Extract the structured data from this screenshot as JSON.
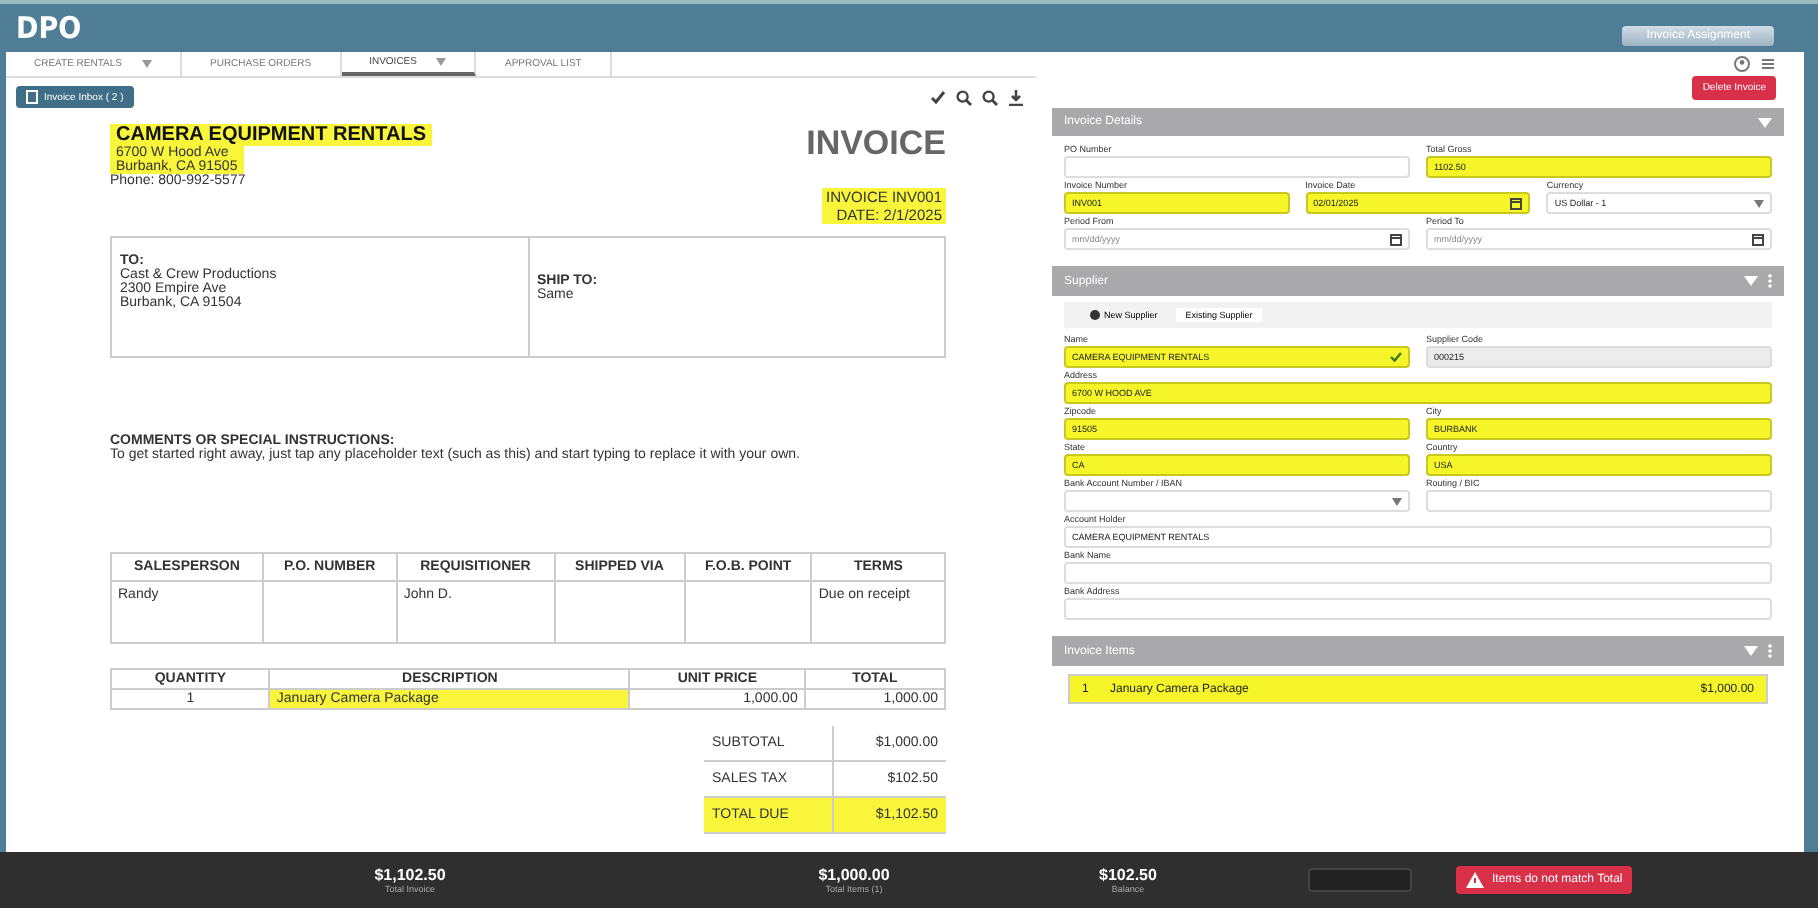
{
  "app": {
    "logo": "DPO",
    "assignment_badge": "Invoice Assignment"
  },
  "tabs": [
    {
      "label": "CREATE RENTALS",
      "selected": false,
      "dropdown": true
    },
    {
      "label": "PURCHASE ORDERS",
      "selected": false,
      "dropdown": false
    },
    {
      "label": "INVOICES",
      "selected": true,
      "dropdown": true
    },
    {
      "label": "APPROVAL LIST",
      "selected": false,
      "dropdown": false
    }
  ],
  "inbox_button": "Invoice Inbox ( 2 )",
  "document": {
    "company": {
      "name": "CAMERA EQUIPMENT RENTALS",
      "address_lines": [
        "6700 W Hood Ave",
        "Burbank, CA 91505"
      ],
      "phone": "Phone: 800-992-5577"
    },
    "title": "INVOICE",
    "invoice_number": "INVOICE INV001",
    "date": "DATE: 2/1/2025",
    "to": {
      "heading": "TO:",
      "lines": [
        "Cast & Crew Productions",
        "2300 Empire Ave",
        "Burbank, CA 91504"
      ]
    },
    "ship_to": {
      "heading": "SHIP TO:",
      "lines": [
        "Same"
      ]
    },
    "comments": {
      "heading": "COMMENTS OR SPECIAL INSTRUCTIONS:",
      "text": "To get started right away, just tap any placeholder text (such as this) and start typing to replace it with your own."
    },
    "order_table": {
      "columns": [
        "SALESPERSON",
        "P.O. NUMBER",
        "REQUISITIONER",
        "SHIPPED VIA",
        "F.O.B. POINT",
        "TERMS"
      ],
      "rows": [
        [
          "Randy",
          "",
          "John D.",
          "",
          "",
          "Due on receipt"
        ]
      ]
    },
    "items_table": {
      "columns": [
        "QUANTITY",
        "DESCRIPTION",
        "UNIT PRICE",
        "TOTAL"
      ],
      "rows": [
        {
          "cells": [
            "1",
            "January Camera Package",
            "1,000.00",
            "1,000.00"
          ],
          "highlighted": true
        }
      ]
    },
    "totals": [
      {
        "label": "SUBTOTAL",
        "value": "$1,000.00",
        "highlighted": false
      },
      {
        "label": "SALES TAX",
        "value": "$102.50",
        "highlighted": false
      },
      {
        "label": "TOTAL DUE",
        "value": "$1,102.50",
        "highlighted": true
      }
    ]
  },
  "delete_button": "Delete Invoice",
  "invoice_details": {
    "title": "Invoice Details",
    "rows": [
      [
        {
          "label": "PO Number",
          "kind": "text",
          "highlighted": false
        },
        {
          "label": "Total Gross",
          "kind": "text",
          "value": "1102.50",
          "highlighted": true
        }
      ],
      [
        {
          "label": "Invoice Number",
          "kind": "text",
          "value": "INV001",
          "highlighted": true
        },
        {
          "label": "Invoice Date",
          "kind": "date",
          "value": "02/01/2025",
          "highlighted": true
        },
        {
          "label": "Currency",
          "kind": "select",
          "value": "US Dollar - 1",
          "highlighted": false
        }
      ],
      [
        {
          "label": "Period From",
          "kind": "date",
          "placeholder": "mm/dd/yyyy",
          "highlighted": false
        },
        {
          "label": "Period To",
          "kind": "date",
          "placeholder": "mm/dd/yyyy",
          "highlighted": false
        }
      ]
    ]
  },
  "supplier": {
    "title": "Supplier",
    "tabs": [
      {
        "label": "New Supplier",
        "selected": true
      },
      {
        "label": "Existing Supplier",
        "selected": false
      }
    ],
    "rows": [
      [
        {
          "label": "Name",
          "kind": "verified",
          "value": "CAMERA EQUIPMENT RENTALS",
          "highlighted": true
        },
        {
          "label": "Supplier Code",
          "kind": "readonly",
          "value": "000215",
          "highlighted": false
        }
      ],
      [
        {
          "label": "Address",
          "kind": "text",
          "value": "6700 W HOOD AVE",
          "highlighted": true
        }
      ],
      [
        {
          "label": "Zipcode",
          "kind": "text",
          "value": "91505",
          "highlighted": true
        },
        {
          "label": "City",
          "kind": "text",
          "value": "BURBANK",
          "highlighted": true
        }
      ],
      [
        {
          "label": "State",
          "kind": "text",
          "value": "CA",
          "highlighted": true
        },
        {
          "label": "Country",
          "kind": "text",
          "value": "USA",
          "highlighted": true
        }
      ],
      [
        {
          "label": "Bank Account Number / IBAN",
          "kind": "select",
          "highlighted": false
        },
        {
          "label": "Routing / BIC",
          "kind": "text",
          "highlighted": false
        }
      ],
      [
        {
          "label": "Account Holder",
          "kind": "text",
          "value": "CAMERA EQUIPMENT RENTALS",
          "highlighted": false
        }
      ],
      [
        {
          "label": "Bank Name",
          "kind": "text",
          "highlighted": false
        }
      ],
      [
        {
          "label": "Bank Address",
          "kind": "text",
          "highlighted": false
        }
      ]
    ]
  },
  "invoice_items": {
    "title": "Invoice Items",
    "items": [
      {
        "number": "1",
        "description": "January Camera Package",
        "amount": "$1,000.00",
        "highlighted": true
      }
    ]
  },
  "footer": {
    "stats": [
      {
        "value": "$1,102.50",
        "label": "Total Invoice"
      },
      {
        "value": "$1,000.00",
        "label": "Total Items (1)"
      },
      {
        "value": "$102.50",
        "label": "Balance"
      }
    ],
    "warning": "Items do not match Total"
  }
}
